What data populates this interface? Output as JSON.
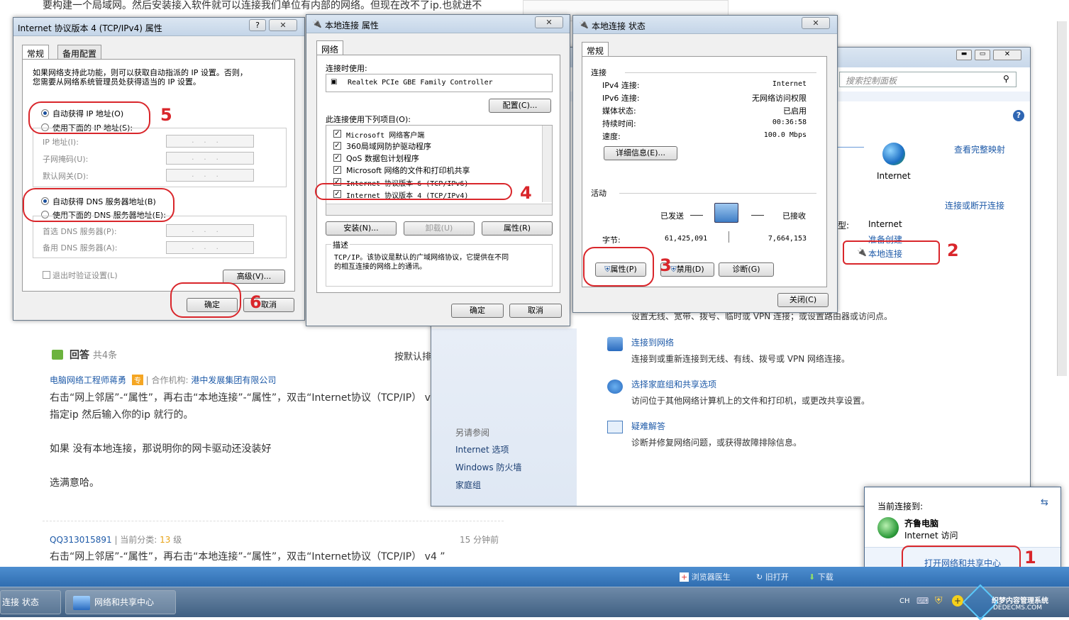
{
  "background": {
    "article_top": "要构建一个局域网。然后安装接入软件就可以连接我们单位有内部的网络。但现在改不了ip.也就进不",
    "answers_title": "回答",
    "answers_count": "共4条",
    "sort_label": "按默认排",
    "answer1": {
      "author": "电脑网络工程师蒋勇",
      "badge": "专",
      "org_label": "合作机构:",
      "org": "港中发展集团有限公司",
      "line1": "右击“网上邻居”-“属性”，再右击“本地连接”-“属性”，双击“Internet协议（TCP/IP） v4 ”",
      "line2": "指定ip 然后输入你的ip 就行的。",
      "line3": "如果 没有本地连接，那说明你的网卡驱动还没装好",
      "line4": "选满意哈。"
    },
    "answer2": {
      "author": "QQ313015891",
      "category_label": "当前分类:",
      "level": "13",
      "level_unit": "级",
      "time": "15 分钟前",
      "line1": "右击“网上邻居”-“属性”，再右击“本地连接”-“属性”，双击“Internet协议（TCP/IP） v4 ”"
    }
  },
  "ipv4_dialog": {
    "title": "Internet 协议版本 4 (TCP/IPv4) 属性",
    "help": "?",
    "close": "✕",
    "tabs": [
      "常规",
      "备用配置"
    ],
    "intro1": "如果网络支持此功能，则可以获取自动指派的 IP 设置。否则，",
    "intro2": "您需要从网络系统管理员处获得适当的 IP 设置。",
    "auto_ip": "自动获得 IP 地址(O)",
    "manual_ip": "使用下面的 IP 地址(S):",
    "ip_label": "IP 地址(I):",
    "mask_label": "子网掩码(U):",
    "gateway_label": "默认网关(D):",
    "auto_dns": "自动获得 DNS 服务器地址(B)",
    "manual_dns": "使用下面的 DNS 服务器地址(E):",
    "pref_dns": "首选 DNS 服务器(P):",
    "alt_dns": "备用 DNS 服务器(A):",
    "ip_dots": "...",
    "validate": "退出时验证设置(L)",
    "advanced": "高级(V)...",
    "ok": "确定",
    "cancel": "取消"
  },
  "conn_props": {
    "title": "本地连接 属性",
    "close": "✕",
    "tab": "网络",
    "connect_using": "连接时使用:",
    "adapter": "Realtek PCIe GBE Family Controller",
    "configure": "配置(C)...",
    "items_label": "此连接使用下列项目(O):",
    "items": [
      "Microsoft 网络客户端",
      "360局域网防护驱动程序",
      "QoS 数据包计划程序",
      "Microsoft 网络的文件和打印机共享",
      "Internet 协议版本 6 (TCP/IPv6)",
      "Internet 协议版本 4 (TCP/IPv4)"
    ],
    "install": "安装(N)...",
    "uninstall": "卸载(U)",
    "properties": "属性(R)",
    "desc_label": "描述",
    "desc1": "TCP/IP。该协议是默认的广域网络协议，它提供在不同",
    "desc2": "的相互连接的网络上的通讯。",
    "ok": "确定",
    "cancel": "取消"
  },
  "status_dialog": {
    "title": "本地连接 状态",
    "close": "✕",
    "tab": "常规",
    "connection": "连接",
    "rows": [
      {
        "k": "IPv4 连接:",
        "v": "Internet"
      },
      {
        "k": "IPv6 连接:",
        "v": "无网络访问权限"
      },
      {
        "k": "媒体状态:",
        "v": "已启用"
      },
      {
        "k": "持续时间:",
        "v": "00:36:58"
      },
      {
        "k": "速度:",
        "v": "100.0 Mbps"
      }
    ],
    "details": "详细信息(E)...",
    "activity": "活动",
    "sent": "已发送",
    "received": "已接收",
    "bytes": "字节:",
    "bytes_sent": "61,425,091",
    "bytes_recv": "7,664,153",
    "properties": "属性(P)",
    "disable": "禁用(D)",
    "diagnose": "诊断(G)",
    "close_btn": "关闭(C)"
  },
  "control_panel": {
    "search_placeholder": "搜索控制面板",
    "view_full_map": "查看完整映射",
    "internet": "Internet",
    "connect_disconnect": "连接或断开连接",
    "access_type_label": "型:",
    "access_type": "Internet",
    "homegroup_label": "准备创建",
    "connections_label": "本地连接",
    "setup_desc": "设置无线、宽带、拨号、临时或 VPN 连接；或设置路由器或访问点。",
    "tasks": [
      {
        "title": "连接到网络",
        "desc": "连接到或重新连接到无线、有线、拨号或 VPN 网络连接。"
      },
      {
        "title": "选择家庭组和共享选项",
        "desc": "访问位于其他网络计算机上的文件和打印机，或更改共享设置。"
      },
      {
        "title": "疑难解答",
        "desc": "诊断并修复网络问题，或获得故障排除信息。"
      }
    ],
    "see_also": "另请参阅",
    "see_also_items": [
      "Internet 选项",
      "Windows 防火墙",
      "家庭组"
    ]
  },
  "network_popup": {
    "header": "当前连接到:",
    "network_name": "齐鲁电脑",
    "access": "Internet 访问",
    "open_center": "打开网络和共享中心"
  },
  "ie_bar": {
    "items": [
      "浏览器医生",
      "旧打开",
      "下载"
    ]
  },
  "taskbar": {
    "item1": "连接 状态",
    "item2": "网络和共享中心",
    "lang": "CH",
    "watermark1": "织梦内容管理系统",
    "watermark2": "DEDECMS.COM"
  },
  "annotations": [
    "1",
    "2",
    "3",
    "4",
    "5",
    "6"
  ],
  "colors": {
    "annotation_red": "#d9262b",
    "link_blue": "#1e5aa8"
  }
}
